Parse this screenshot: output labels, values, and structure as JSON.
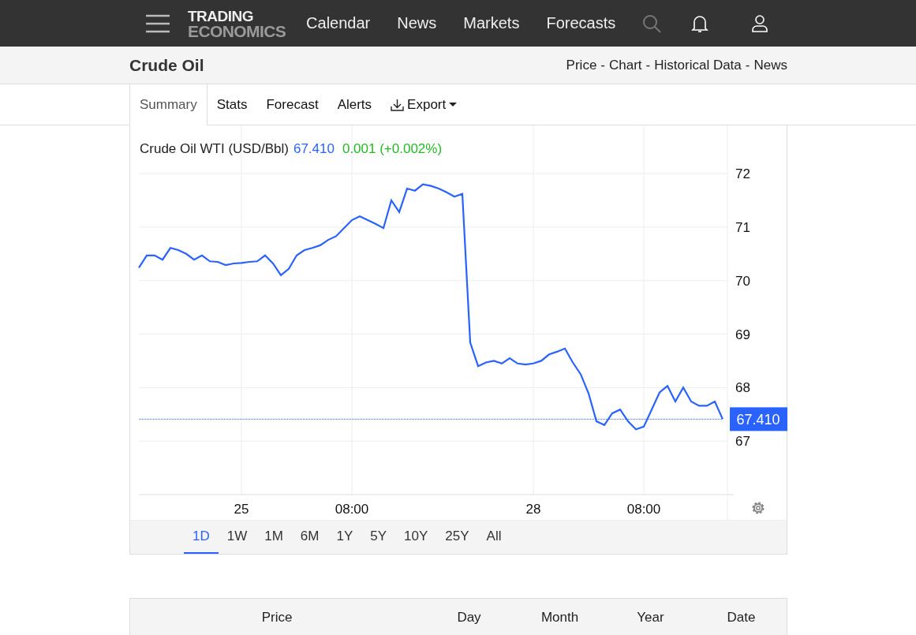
{
  "nav": {
    "logo_top": "TRADING",
    "logo_bottom": "ECONOMICS",
    "links": [
      "Calendar",
      "News",
      "Markets",
      "Forecasts"
    ]
  },
  "header": {
    "title": "Crude Oil",
    "links": [
      "Price",
      "Chart",
      "Historical Data",
      "News"
    ],
    "separator": "-"
  },
  "tabs": [
    {
      "label": "Summary",
      "selected": true
    },
    {
      "label": "Stats",
      "selected": false
    },
    {
      "label": "Forecast",
      "selected": false
    },
    {
      "label": "Alerts",
      "selected": false
    },
    {
      "label": "Export",
      "selected": false,
      "kind": "dropdown"
    }
  ],
  "chart": {
    "name": "Crude Oil WTI (USD/Bbl)",
    "price": "67.410",
    "change": "0.001 (+0.002%)",
    "last_label": "67.410",
    "chart_data": {
      "type": "line",
      "categories": [
        null,
        null,
        null,
        null,
        null,
        null,
        null,
        null,
        null,
        null,
        null,
        null,
        null,
        "25",
        null,
        null,
        null,
        null,
        null,
        null,
        null,
        null,
        null,
        null,
        null,
        null,
        null,
        "08:00",
        null,
        null,
        null,
        null,
        null,
        null,
        null,
        null,
        null,
        null,
        null,
        null,
        null,
        null,
        null,
        null,
        null,
        null,
        null,
        null,
        null,
        null,
        "28",
        null,
        null,
        null,
        null,
        null,
        null,
        null,
        null,
        null,
        null,
        null,
        null,
        null,
        "08:00",
        null,
        null,
        null,
        null,
        null,
        null,
        null,
        null,
        null,
        null
      ],
      "series": [
        {
          "color": "#2962ff",
          "values": [
            70.24,
            70.47,
            70.47,
            70.39,
            70.61,
            70.57,
            70.5,
            70.39,
            70.47,
            70.36,
            70.35,
            70.29,
            70.32,
            70.33,
            70.35,
            70.36,
            70.47,
            70.32,
            70.1,
            70.22,
            70.47,
            70.57,
            70.61,
            70.66,
            70.76,
            70.83,
            70.98,
            71.13,
            71.2,
            71.13,
            71.06,
            70.98,
            71.5,
            71.28,
            71.72,
            71.68,
            71.8,
            71.77,
            71.72,
            71.65,
            71.57,
            71.62,
            68.84,
            68.4,
            68.47,
            68.5,
            68.45,
            68.55,
            68.45,
            68.43,
            68.45,
            68.5,
            68.62,
            68.67,
            68.73,
            68.47,
            68.25,
            67.89,
            67.37,
            67.3,
            67.52,
            67.59,
            67.37,
            67.22,
            67.27,
            67.59,
            67.91,
            68.03,
            67.74,
            68.0,
            67.74,
            67.66,
            67.66,
            67.74,
            67.41
          ]
        },
        {
          "color": "#2962ff",
          "line_style": "dotted",
          "values": [
            67.41,
            67.41,
            67.41,
            67.41,
            67.41,
            67.41,
            67.41,
            67.41,
            67.41,
            67.41,
            67.41,
            67.41,
            67.41,
            67.41,
            67.41,
            67.41,
            67.41,
            67.41,
            67.41,
            67.41,
            67.41,
            67.41,
            67.41,
            67.41,
            67.41,
            67.41,
            67.41,
            67.41,
            67.41,
            67.41,
            67.41,
            67.41,
            67.41,
            67.41,
            67.41,
            67.41,
            67.41,
            67.41,
            67.41,
            67.41,
            67.41,
            67.41,
            67.41,
            67.41,
            67.41,
            67.41,
            67.41,
            67.41,
            67.41,
            67.41,
            67.41,
            67.41,
            67.41,
            67.41,
            67.41,
            67.41,
            67.41,
            67.41,
            67.41,
            67.41,
            67.41,
            67.41,
            67.41,
            67.41,
            67.41,
            67.41,
            67.41,
            67.41,
            67.41,
            67.41,
            67.41,
            67.41,
            67.41,
            67.41,
            67.41
          ]
        }
      ],
      "ylim": [
        66,
        72.9
      ],
      "grid": true,
      "yticks": [
        67,
        68,
        69,
        70,
        71,
        72
      ]
    }
  },
  "ranges": [
    {
      "label": "1D",
      "selected": true
    },
    {
      "label": "1W",
      "selected": false
    },
    {
      "label": "1M",
      "selected": false
    },
    {
      "label": "6M",
      "selected": false
    },
    {
      "label": "1Y",
      "selected": false
    },
    {
      "label": "5Y",
      "selected": false
    },
    {
      "label": "10Y",
      "selected": false
    },
    {
      "label": "25Y",
      "selected": false
    },
    {
      "label": "All",
      "selected": false
    }
  ],
  "table": {
    "columns": [
      "Price",
      "Day",
      "Month",
      "Year",
      "Date"
    ]
  }
}
